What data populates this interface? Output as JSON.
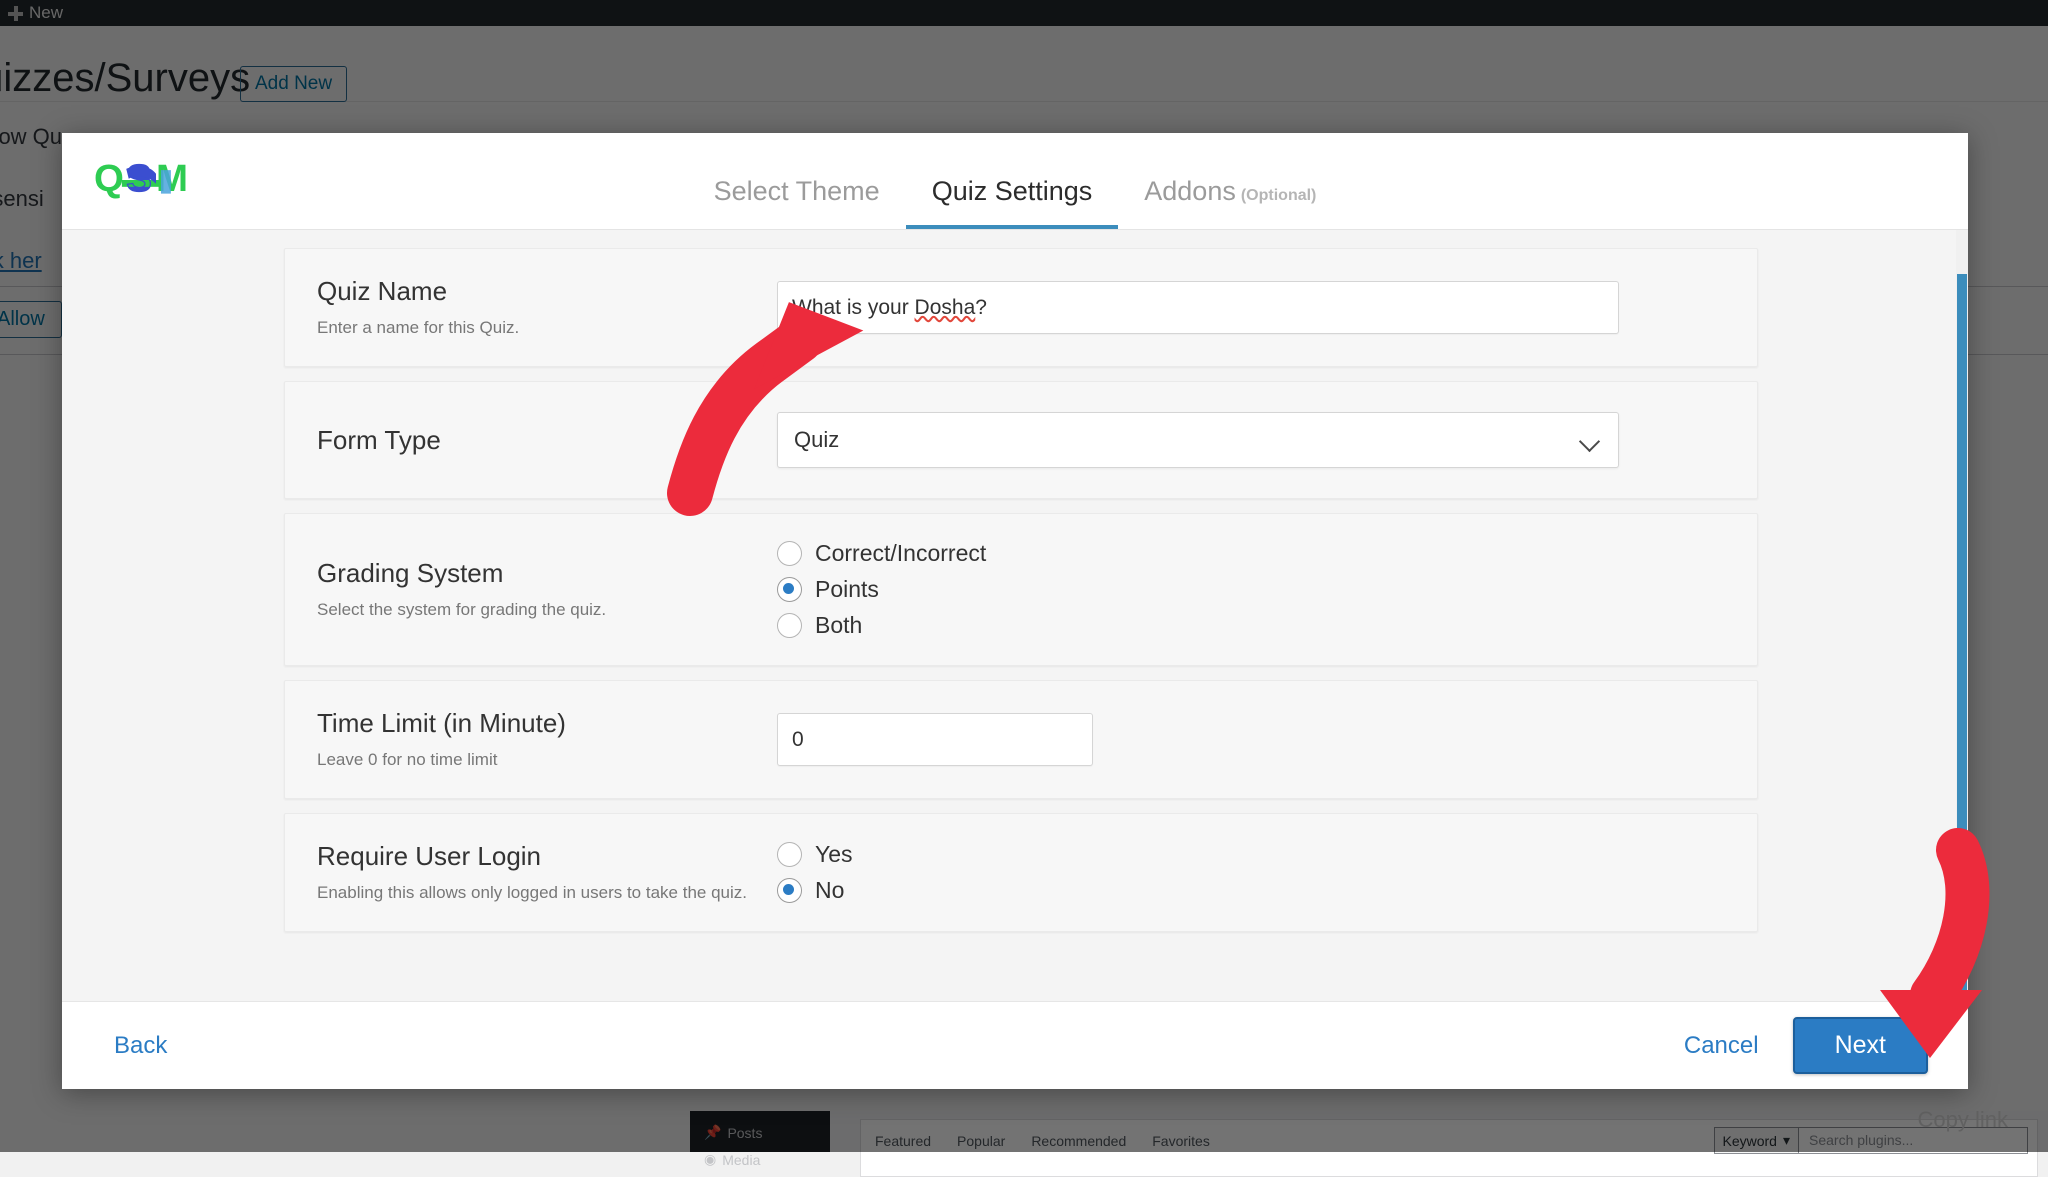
{
  "colors": {
    "accent_blue": "#2b7cc4",
    "tab_underline": "#3c8dbc",
    "radio_selected": "#2b7cc4",
    "arrow_red": "#ec2b3c",
    "logo_green": "#2ecc52",
    "logo_blue": "#3b4ed0",
    "overlay": "rgba(0,0,0,0.55)"
  },
  "background": {
    "adminbar": {
      "new_label": "New",
      "new_icon": "plus-icon"
    },
    "page_title": "Quizzes/Surveys",
    "add_new_label": "Add New",
    "notice_lines": [
      "Allow Qu",
      "o sensi"
    ],
    "notice_link": "lick her",
    "allow_button": "Allow",
    "plugins_panel": {
      "sidebar_items": [
        "Posts",
        "Media"
      ],
      "tabs": [
        "Featured",
        "Popular",
        "Recommended",
        "Favorites"
      ],
      "keyword_select": "Keyword",
      "search_placeholder": "Search plugins...",
      "copy_link": "Copy link"
    }
  },
  "modal": {
    "logo_alt": "QSM",
    "tabs": [
      {
        "label": "Select Theme",
        "sub": "",
        "active": false
      },
      {
        "label": "Quiz Settings",
        "sub": "",
        "active": true
      },
      {
        "label": "Addons",
        "sub": "(Optional)",
        "active": false
      }
    ],
    "settings": [
      {
        "id": "quiz-name",
        "label": "Quiz Name",
        "desc": "Enter a name for this Quiz.",
        "field_type": "text",
        "value": "What is your Dosha?",
        "spellcheck_word": "Dosha"
      },
      {
        "id": "form-type",
        "label": "Form Type",
        "desc": "",
        "field_type": "select",
        "value": "Quiz"
      },
      {
        "id": "grading-system",
        "label": "Grading System",
        "desc": "Select the system for grading the quiz.",
        "field_type": "radio",
        "options": [
          {
            "label": "Correct/Incorrect",
            "selected": false
          },
          {
            "label": "Points",
            "selected": true
          },
          {
            "label": "Both",
            "selected": false
          }
        ]
      },
      {
        "id": "time-limit",
        "label": "Time Limit (in Minute)",
        "desc": "Leave 0 for no time limit",
        "field_type": "text-small",
        "value": "0"
      },
      {
        "id": "require-user-login",
        "label": "Require User Login",
        "desc": "Enabling this allows only logged in users to take the quiz.",
        "field_type": "radio",
        "options": [
          {
            "label": "Yes",
            "selected": false
          },
          {
            "label": "No",
            "selected": true
          }
        ]
      }
    ],
    "footer": {
      "back_label": "Back",
      "cancel_label": "Cancel",
      "next_label": "Next"
    }
  }
}
